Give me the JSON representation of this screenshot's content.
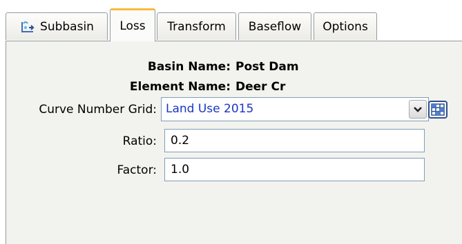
{
  "tabs": [
    {
      "label": "Subbasin",
      "icon": "subbasin-icon",
      "active": false
    },
    {
      "label": "Loss",
      "active": true
    },
    {
      "label": "Transform",
      "active": false
    },
    {
      "label": "Baseflow",
      "active": false
    },
    {
      "label": "Options",
      "active": false
    }
  ],
  "basin": {
    "label": "Basin Name:",
    "value": "Post Dam"
  },
  "element": {
    "label": "Element Name:",
    "value": "Deer Cr"
  },
  "curve_number_grid": {
    "label": "Curve Number Grid:",
    "value": "Land Use 2015"
  },
  "ratio": {
    "label": "Ratio:",
    "value": "0.2"
  },
  "factor": {
    "label": "Factor:",
    "value": "1.0"
  },
  "colors": {
    "accent_tab": "#f9b93c",
    "link_text": "#1a35c4"
  }
}
